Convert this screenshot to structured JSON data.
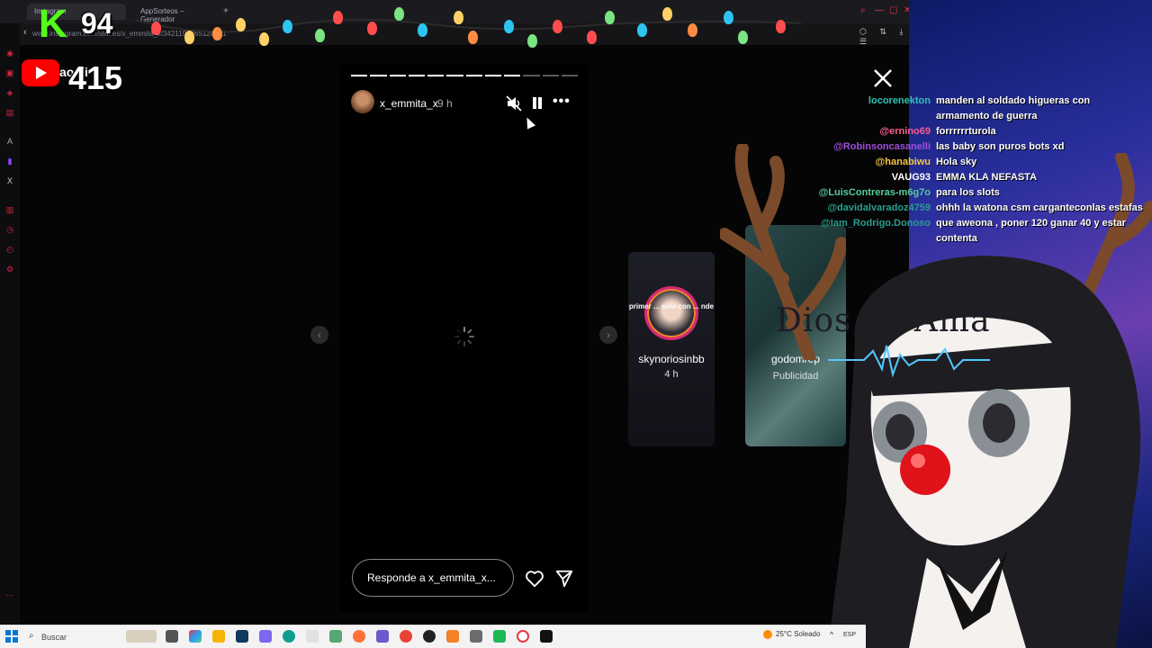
{
  "browser": {
    "tabs": [
      {
        "label": "Instagram"
      },
      {
        "label": "AppSorteos – Generador"
      }
    ],
    "new_tab": "+",
    "back": "‹",
    "url": "www.instagram.com/stories/x_emmita_x/3421191865128731",
    "toolbar_icons": "⬡ ⇅ ⤓ ☰"
  },
  "overlay": {
    "kick_logo": "K",
    "kick_viewers": "94",
    "youtube_ghost": "ao..li",
    "youtube_viewers": "415"
  },
  "story": {
    "username": "x_emmita_x",
    "time": "9 h",
    "progress_segments_total": 12,
    "progress_segments_done": 9,
    "reply_placeholder": "Responde a x_emmita_x...",
    "more": "•••"
  },
  "preview_cards": [
    {
      "name": "skynoriosinbb",
      "sub": "4 h",
      "banner": "primer ... solo con ... nde"
    },
    {
      "name": "godomrep",
      "sub": "Publicidad"
    }
  ],
  "chat": [
    {
      "user": "locorenekton",
      "color": "#2ec4b6",
      "message": "manden al soldado higueras con armamento de guerra"
    },
    {
      "user": "@ernino69",
      "color": "#ff5d8f",
      "message": "forrrrrrturola"
    },
    {
      "user": "@Robinsoncasanelli",
      "color": "#9d4edd",
      "message": "las baby son puros bots xd"
    },
    {
      "user": "@hanabiwu",
      "color": "#f4c542",
      "message": "Hola sky"
    },
    {
      "user": "VAUG93",
      "color": "#ffffff",
      "message": "EMMA KLA NEFASTA"
    },
    {
      "user": "@LuisContreras-m6g7o",
      "color": "#57cc99",
      "message": "para los slots"
    },
    {
      "user": "@davidalvaradoz4759",
      "color": "#2a9d8f",
      "message": "ohhh la watona csm carganteconlas estafas"
    },
    {
      "user": "@Iam_Rodrigo.Donoso",
      "color": "#2a9d8f",
      "message": "que aweona , poner 120 ganar 40 y estar contenta"
    }
  ],
  "overlay_text": {
    "dios": "Dios Te Ama"
  },
  "taskbar": {
    "search_label": "Buscar",
    "weather": "25°C Soleado",
    "lang": "ESP",
    "tray_up": "^"
  }
}
